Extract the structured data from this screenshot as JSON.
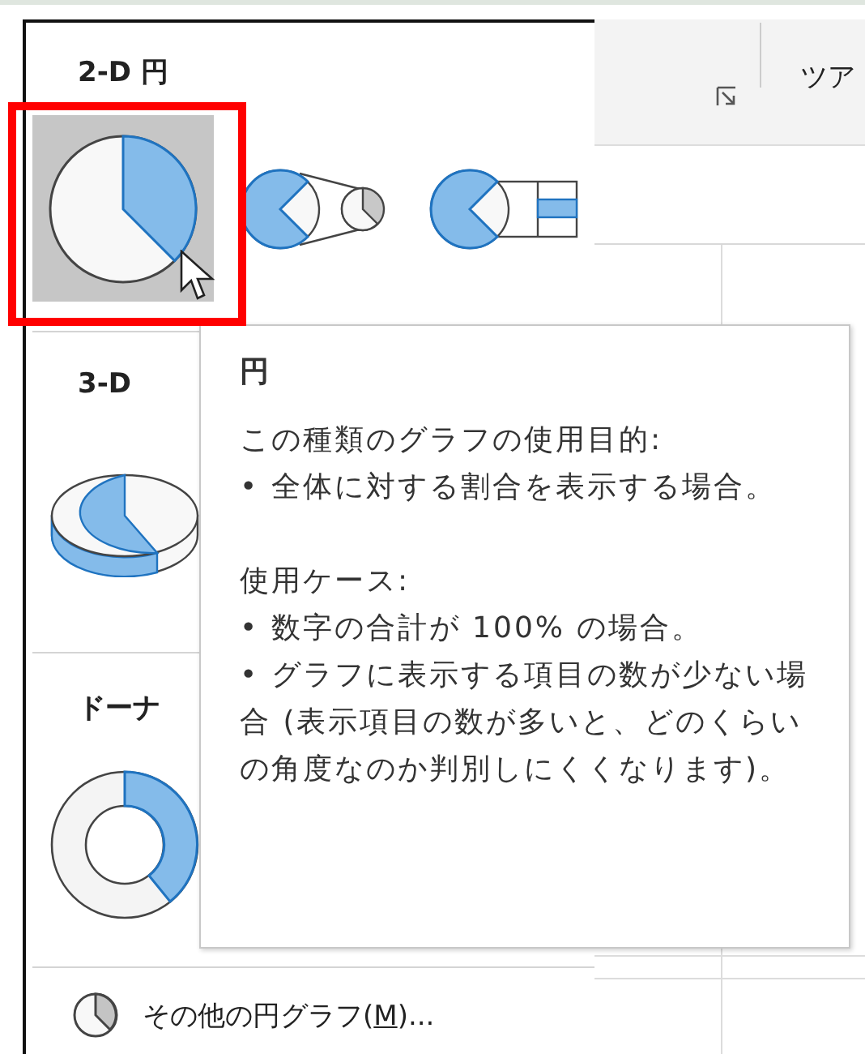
{
  "gallery": {
    "sections": [
      {
        "heading": "2-D 円",
        "items": [
          {
            "kind": "pie",
            "selected": true
          },
          {
            "kind": "pie-of-pie",
            "selected": false
          },
          {
            "kind": "bar-of-pie",
            "selected": false
          }
        ]
      },
      {
        "heading": "3-D",
        "items": [
          {
            "kind": "pie-3d",
            "selected": false
          }
        ]
      },
      {
        "heading": "ドーナ",
        "items": [
          {
            "kind": "doughnut",
            "selected": false
          }
        ]
      }
    ],
    "more": {
      "label_before": "その他の円グラフ(",
      "access_key": "M",
      "label_after": ")..."
    }
  },
  "ribbon": {
    "tab_text": "ツア"
  },
  "tooltip": {
    "title": "円",
    "blocks": [
      {
        "paragraphs": [
          "この種類のグラフの使用目的:",
          "• 全体に対する割合を表示する場合。"
        ]
      },
      {
        "paragraphs": [
          "使用ケース:",
          "• 数字の合計が 100% の場合。",
          "• グラフに表示する項目の数が少ない場合 (表示項目の数が多いと、どのくらいの角度なのか判別しにくくなります)。"
        ]
      }
    ]
  }
}
